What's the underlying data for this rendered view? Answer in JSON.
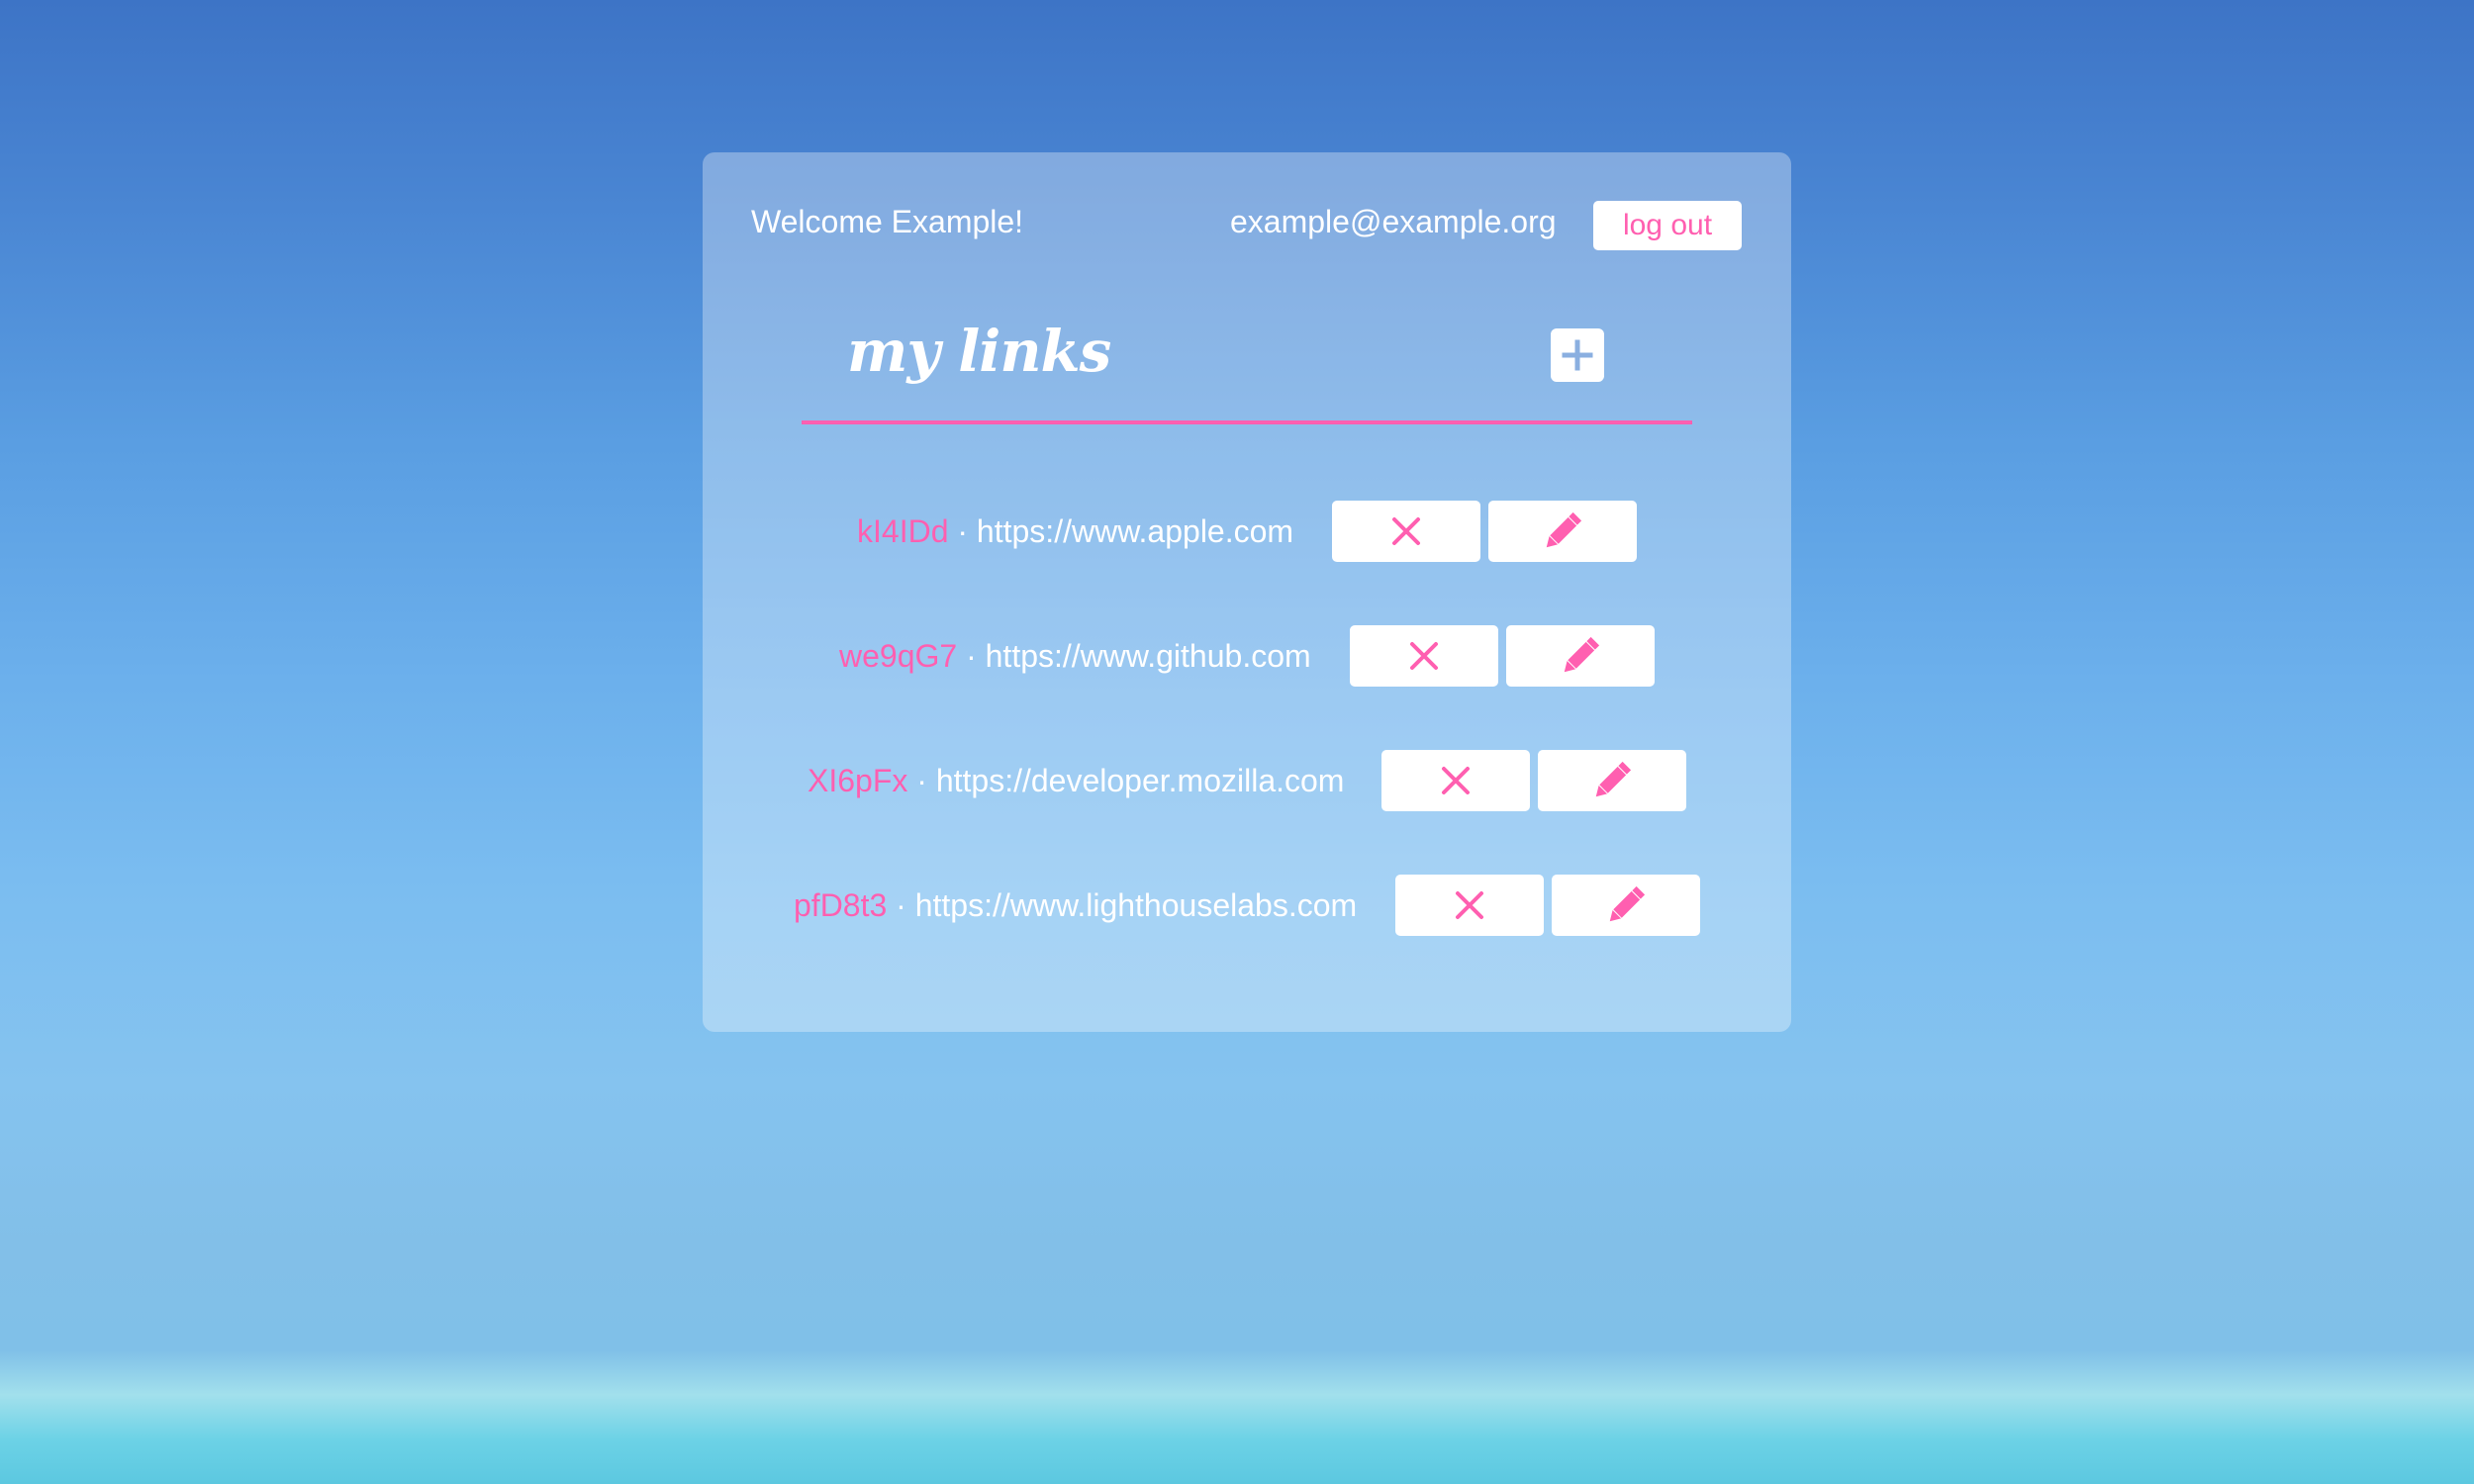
{
  "header": {
    "welcome": "Welcome Example!",
    "email": "example@example.org",
    "logout_label": "log out"
  },
  "links_section": {
    "title": "my links",
    "add_icon": "plus-icon",
    "delete_icon": "close-icon",
    "edit_icon": "pencil-icon",
    "separator": "·"
  },
  "links": [
    {
      "code": "kI4IDd",
      "url": "https://www.apple.com"
    },
    {
      "code": "we9qG7",
      "url": "https://www.github.com"
    },
    {
      "code": "XI6pFx",
      "url": "https://developer.mozilla.com"
    },
    {
      "code": "pfD8t3",
      "url": "https://www.lighthouselabs.com"
    }
  ],
  "colors": {
    "accent": "#ff5fb0",
    "add_icon": "#8aafe0",
    "panel": "rgba(255,255,255,0.32)"
  }
}
